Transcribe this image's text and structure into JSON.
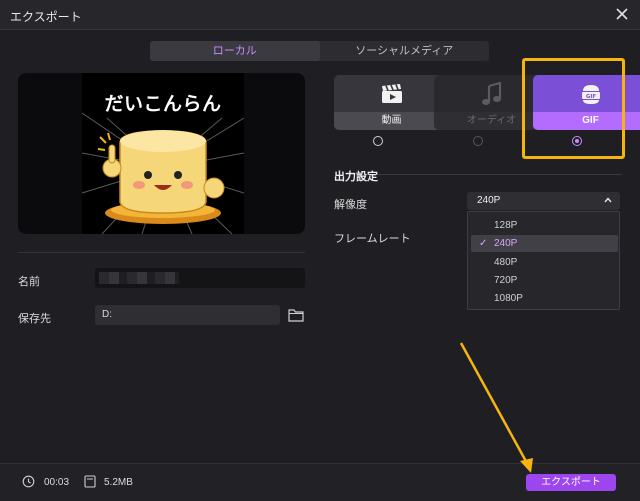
{
  "window": {
    "title": "エクスポート"
  },
  "tabs": [
    {
      "label": "ローカル",
      "active": true
    },
    {
      "label": "ソーシャルメディア",
      "active": false
    }
  ],
  "preview": {
    "image_title": "だいこんらん"
  },
  "form": {
    "name_label": "名前",
    "name_value": "",
    "save_label": "保存先",
    "save_value": "D:"
  },
  "formats": [
    {
      "label": "動画",
      "icon": "video-clapper-icon",
      "state": "normal"
    },
    {
      "label": "オーディオ",
      "icon": "music-note-icon",
      "state": "disabled"
    },
    {
      "label": "GIF",
      "icon": "gif-icon",
      "state": "selected"
    }
  ],
  "output_settings": {
    "section_title": "出力設定",
    "resolution_label": "解像度",
    "resolution_value": "240P",
    "framerate_label": "フレームレート",
    "resolution_options": [
      "128P",
      "240P",
      "480P",
      "720P",
      "1080P"
    ],
    "selected_option": "240P"
  },
  "footer": {
    "duration": "00:03",
    "size": "5.2MB",
    "export_label": "エクスポート"
  },
  "colors": {
    "accent": "#9d45ef",
    "highlight_box": "#f6b40d",
    "background": "#1f1f23"
  }
}
